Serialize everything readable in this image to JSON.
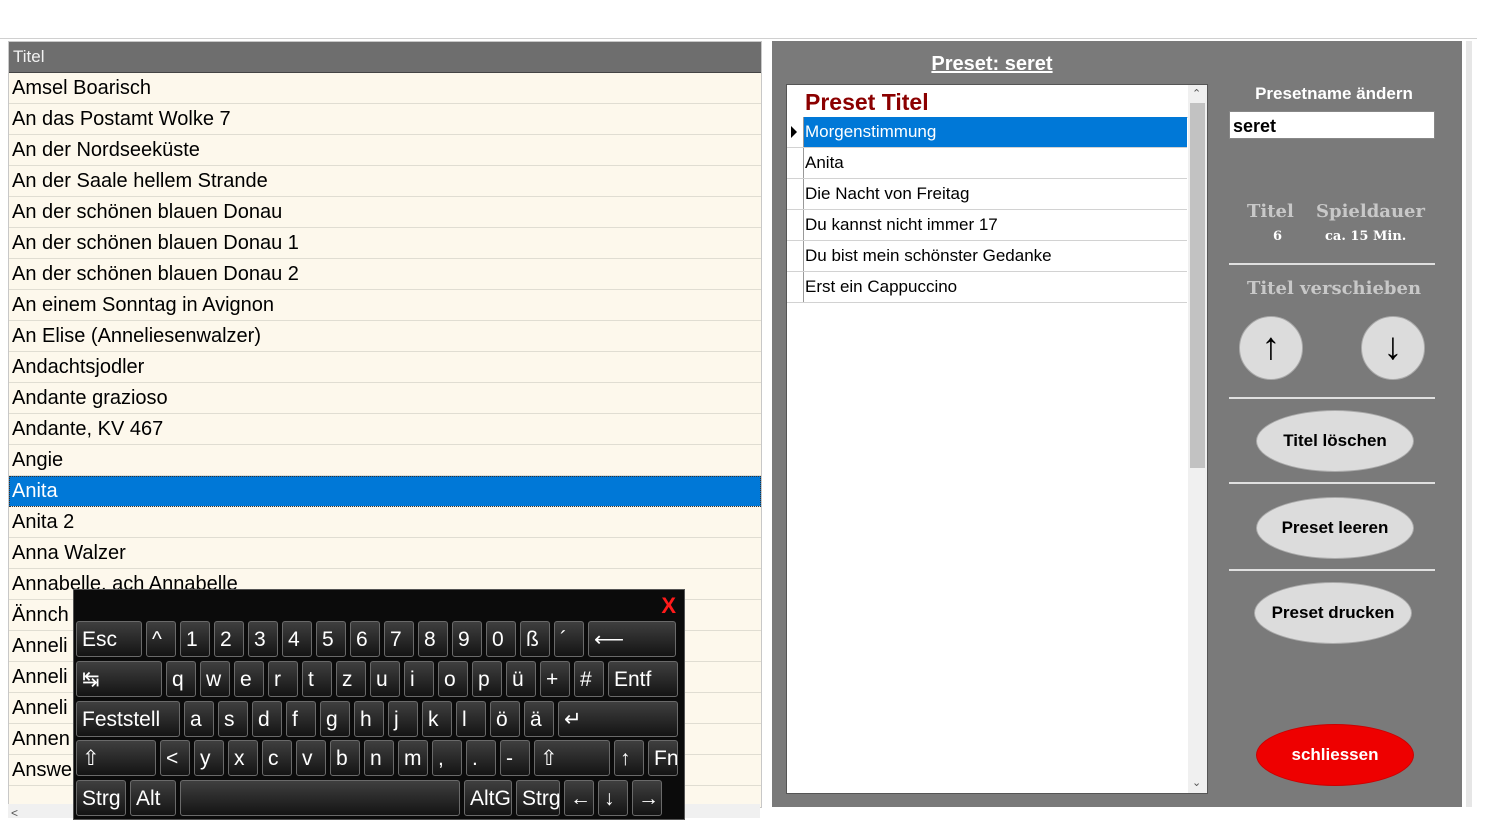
{
  "song_list": {
    "header": "Titel",
    "items": [
      "Amsel Boarisch",
      "An das Postamt Wolke 7",
      "An der Nordseeküste",
      "An der Saale hellem Strande",
      "An der schönen blauen Donau",
      "An der schönen blauen Donau 1",
      "An der schönen blauen Donau 2",
      "An einem Sonntag in Avignon",
      "An Elise (Anneliesenwalzer)",
      "Andachtsjodler",
      "Andante grazioso",
      "Andante, KV 467",
      "Angie",
      "Anita",
      "Anita 2",
      "Anna Walzer",
      "Annabelle, ach Annabelle",
      "Ännch",
      "Anneli",
      "Anneli",
      "Anneli",
      "Annen",
      "Answe"
    ],
    "selected_index": 13
  },
  "preset": {
    "heading": "Preset:  seret",
    "grid_header": "Preset Titel",
    "titles": [
      "Morgenstimmung",
      "Anita",
      "Die Nacht von Freitag",
      "Du kannst nicht immer 17",
      "Du bist mein schönster Gedanke",
      "Erst ein Cappuccino"
    ],
    "selected_index": 0
  },
  "side": {
    "rename_label": "Presetname ändern",
    "name_value": "seret",
    "titel_label": "Titel",
    "titel_count": "6",
    "spieldauer_label": "Spieldauer",
    "spieldauer_value": "ca. 15 Min.",
    "move_label": "Titel verschieben",
    "up_arrow": "↑",
    "down_arrow": "↓",
    "delete_label": "Titel löschen",
    "clear_label": "Preset leeren",
    "print_label": "Preset drucken",
    "close_label": "schliessen"
  },
  "keyboard": {
    "close": "X",
    "row1": [
      "Esc",
      "^",
      "1",
      "2",
      "3",
      "4",
      "5",
      "6",
      "7",
      "8",
      "9",
      "0",
      "ß",
      "´",
      "⟵"
    ],
    "row2": [
      "↹",
      "q",
      "w",
      "e",
      "r",
      "t",
      "z",
      "u",
      "i",
      "o",
      "p",
      "ü",
      "+",
      "#",
      "Entf"
    ],
    "row3": [
      "Feststell",
      "a",
      "s",
      "d",
      "f",
      "g",
      "h",
      "j",
      "k",
      "l",
      "ö",
      "ä",
      "↵"
    ],
    "row4": [
      "⇧",
      "<",
      "y",
      "x",
      "c",
      "v",
      "b",
      "n",
      "m",
      ",",
      ".",
      "-",
      "⇧",
      "↑",
      "Fn"
    ],
    "row5": [
      "Strg",
      "Alt",
      "",
      "AltGr",
      "Strg",
      "←",
      "↓",
      "→"
    ]
  },
  "colors": {
    "selection": "#0078d7",
    "panel_bg": "#7a7a7a",
    "preset_header": "#8b0000",
    "close_button": "#ee0000"
  }
}
